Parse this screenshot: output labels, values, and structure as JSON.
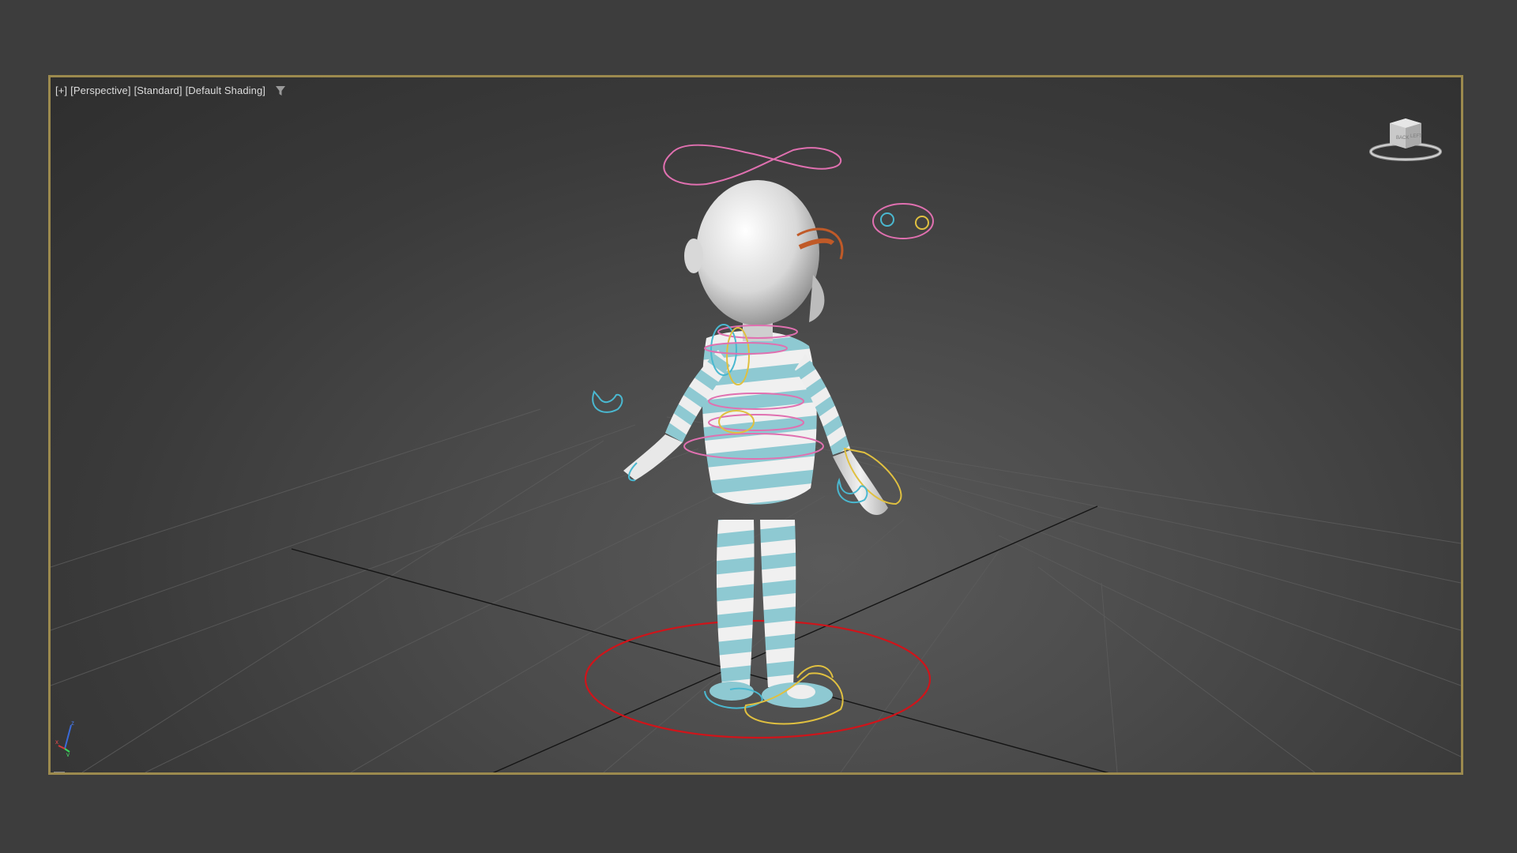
{
  "viewport": {
    "label_plus": "[+]",
    "label_view": "[Perspective]",
    "label_camera": "[Standard]",
    "label_shading": "[Default Shading]",
    "filter_icon": "filter-icon",
    "border_color": "#9c8a4e"
  },
  "viewcube": {
    "face_label_1": "BACK",
    "face_label_2": "LEFT"
  },
  "axis": {
    "x_label": "x",
    "y_label": "y",
    "z_label": "z"
  },
  "colors": {
    "root_control": "#d0141a",
    "control_pink": "#e070b0",
    "control_cyan": "#4ab8d0",
    "control_yellow": "#e0c040",
    "control_orange": "#c05a28",
    "shirt_stripe": "#8ec9d2"
  }
}
